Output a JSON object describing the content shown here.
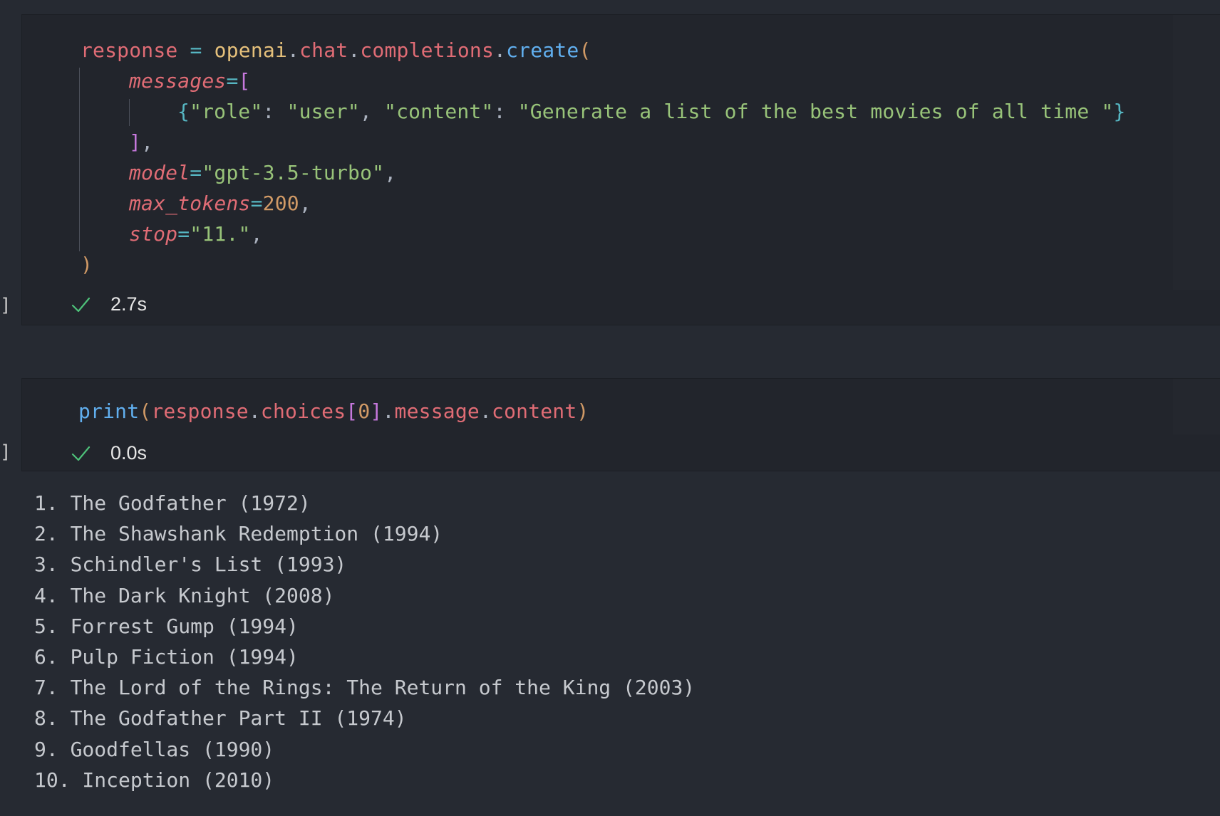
{
  "cell1": {
    "lines": [
      [
        [
          "v",
          "response"
        ],
        [
          "p",
          " "
        ],
        [
          "o",
          "="
        ],
        [
          "p",
          " "
        ],
        [
          "y",
          "openai"
        ],
        [
          "p",
          "."
        ],
        [
          "v",
          "chat"
        ],
        [
          "p",
          "."
        ],
        [
          "v",
          "completions"
        ],
        [
          "p",
          "."
        ],
        [
          "f",
          "create"
        ],
        [
          "b",
          "("
        ]
      ],
      [
        [
          "i",
          "messages"
        ],
        [
          "o",
          "="
        ],
        [
          "m",
          "["
        ]
      ],
      [
        [
          "o",
          "{"
        ],
        [
          "s",
          "\"role\""
        ],
        [
          "p",
          ": "
        ],
        [
          "s",
          "\"user\""
        ],
        [
          "p",
          ", "
        ],
        [
          "s",
          "\"content\""
        ],
        [
          "p",
          ": "
        ],
        [
          "s",
          "\"Generate a list of the best movies of all time \""
        ],
        [
          "o",
          "}"
        ]
      ],
      [
        [
          "m",
          "]"
        ],
        [
          "p",
          ","
        ]
      ],
      [
        [
          "i",
          "model"
        ],
        [
          "o",
          "="
        ],
        [
          "s",
          "\"gpt-3.5-turbo\""
        ],
        [
          "p",
          ","
        ]
      ],
      [
        [
          "i",
          "max_tokens"
        ],
        [
          "o",
          "="
        ],
        [
          "n",
          "200"
        ],
        [
          "p",
          ","
        ]
      ],
      [
        [
          "i",
          "stop"
        ],
        [
          "o",
          "="
        ],
        [
          "s",
          "\"11.\""
        ],
        [
          "p",
          ","
        ]
      ],
      [
        [
          "b",
          ")"
        ]
      ]
    ],
    "status": {
      "icon": "check-icon",
      "time": "2.7s"
    },
    "bracket": "]"
  },
  "cell2": {
    "lines": [
      [
        [
          "f",
          "print"
        ],
        [
          "b",
          "("
        ],
        [
          "v",
          "response"
        ],
        [
          "p",
          "."
        ],
        [
          "v",
          "choices"
        ],
        [
          "m",
          "["
        ],
        [
          "n",
          "0"
        ],
        [
          "m",
          "]"
        ],
        [
          "p",
          "."
        ],
        [
          "v",
          "message"
        ],
        [
          "p",
          "."
        ],
        [
          "v",
          "content"
        ],
        [
          "b",
          ")"
        ]
      ]
    ],
    "status": {
      "icon": "check-icon",
      "time": "0.0s"
    },
    "bracket": "]"
  },
  "output": [
    "1. The Godfather (1972)",
    "2. The Shawshank Redemption (1994)",
    "3. Schindler's List (1993)",
    "4. The Dark Knight (2008)",
    "5. Forrest Gump (1994)",
    "6. Pulp Fiction (1994)",
    "7. The Lord of the Rings: The Return of the King (2003)",
    "8. The Godfather Part II (1974)",
    "9. Goodfellas (1990)",
    "10. Inception (2010)"
  ],
  "colors": {
    "page_background": "#262a32",
    "cell_background": "#22252c",
    "check": "#4ec27a",
    "output_text": "#c6c9ce"
  }
}
